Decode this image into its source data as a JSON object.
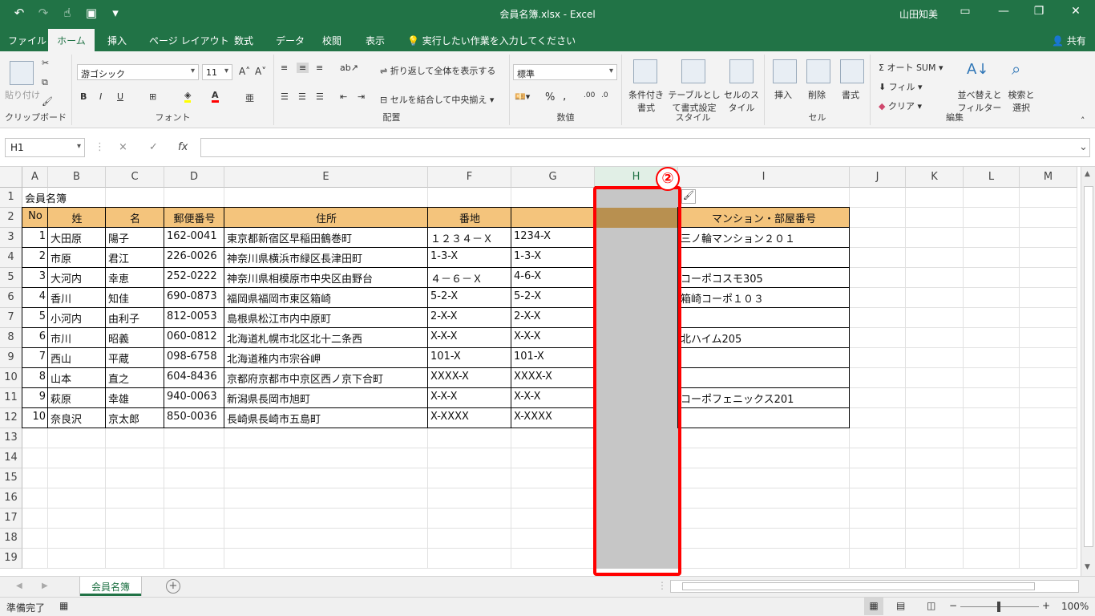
{
  "title_bar": {
    "title": "会員名簿.xlsx  -  Excel",
    "user": "山田知美",
    "undo_icon": "undo-icon",
    "redo_icon": "redo-icon"
  },
  "tabs": [
    "ファイル",
    "ホーム",
    "挿入",
    "ページ レイアウト",
    "数式",
    "データ",
    "校閲",
    "表示"
  ],
  "tell_me": "実行したい作業を入力してください",
  "share": "共有",
  "ribbon": {
    "clipboard": {
      "paste": "貼り付け",
      "label": "クリップボード"
    },
    "font": {
      "name": "游ゴシック",
      "size": "11",
      "bold": "B",
      "italic": "I",
      "underline": "U",
      "label": "フォント"
    },
    "alignment": {
      "wrap": "折り返して全体を表示する",
      "merge": "セルを結合して中央揃え",
      "label": "配置"
    },
    "number": {
      "format": "標準",
      "percent": "%",
      "comma": ",",
      "label": "数値"
    },
    "styles": {
      "conditional": "条件付き書式",
      "table": "テーブルとして書式設定",
      "cell": "セルのスタイル",
      "label": "スタイル"
    },
    "cells": {
      "insert": "挿入",
      "delete": "削除",
      "format": "書式",
      "label": "セル"
    },
    "editing": {
      "autosum": "オート SUM",
      "fill": "フィル",
      "clear": "クリア",
      "sort": "並べ替えとフィルター",
      "find": "検索と選択",
      "label": "編集"
    }
  },
  "formula_bar": {
    "name_box": "H1",
    "cancel": "×",
    "enter": "✓",
    "fx": "fx",
    "value": ""
  },
  "columns": [
    "A",
    "B",
    "C",
    "D",
    "E",
    "F",
    "G",
    "H",
    "I",
    "J",
    "K",
    "L",
    "M"
  ],
  "row_numbers": [
    "1",
    "2",
    "3",
    "4",
    "5",
    "6",
    "7",
    "8",
    "9",
    "10",
    "11",
    "12",
    "13",
    "14",
    "15",
    "16",
    "17",
    "18",
    "19"
  ],
  "sheet": {
    "title": "会員名簿",
    "headers": [
      "No",
      "姓",
      "名",
      "郵便番号",
      "住所",
      "番地",
      "",
      "",
      "マンション・部屋番号"
    ],
    "rows": [
      [
        "1",
        "大田原",
        "陽子",
        "162-0041",
        "東京都新宿区早稲田鶴巻町",
        "１２３４－Ｘ",
        "1234-X",
        "",
        "三ノ輪マンション２０１"
      ],
      [
        "2",
        "市原",
        "君江",
        "226-0026",
        "神奈川県横浜市緑区長津田町",
        "1-3-X",
        "1-3-X",
        "",
        ""
      ],
      [
        "3",
        "大河内",
        "幸恵",
        "252-0222",
        "神奈川県相模原市中央区由野台",
        "４－６－Ｘ",
        "4-6-X",
        "",
        "コーポコスモ305"
      ],
      [
        "4",
        "香川",
        "知佳",
        "690-0873",
        "福岡県福岡市東区箱崎",
        "5-2-X",
        "5-2-X",
        "",
        "箱崎コーポ１０３"
      ],
      [
        "5",
        "小河内",
        "由利子",
        "812-0053",
        "島根県松江市内中原町",
        "2-X-X",
        "2-X-X",
        "",
        ""
      ],
      [
        "6",
        "市川",
        "昭義",
        "060-0812",
        "北海道札幌市北区北十二条西",
        "X-X-X",
        "X-X-X",
        "",
        "北ハイム205"
      ],
      [
        "7",
        "西山",
        "平蔵",
        "098-6758",
        "北海道稚内市宗谷岬",
        "101-X",
        "101-X",
        "",
        ""
      ],
      [
        "8",
        "山本",
        "直之",
        "604-8436",
        "京都府京都市中京区西ノ京下合町",
        "XXXX-X",
        "XXXX-X",
        "",
        ""
      ],
      [
        "9",
        "萩原",
        "幸雄",
        "940-0063",
        "新潟県長岡市旭町",
        "X-X-X",
        "X-X-X",
        "",
        "コーポフェニックス201"
      ],
      [
        "10",
        "奈良沢",
        "京太郎",
        "850-0036",
        "長崎県長崎市五島町",
        "X-XXXX",
        "X-XXXX",
        "",
        ""
      ]
    ]
  },
  "annotation": {
    "badge": "②",
    "color": "#ff0000"
  },
  "sheet_tab": "会員名簿",
  "status": {
    "ready": "準備完了",
    "zoom": "100%"
  },
  "colors": {
    "excel_green": "#217346",
    "header_fill": "#f4c47c",
    "selected_fill": "#c6c6c6"
  }
}
